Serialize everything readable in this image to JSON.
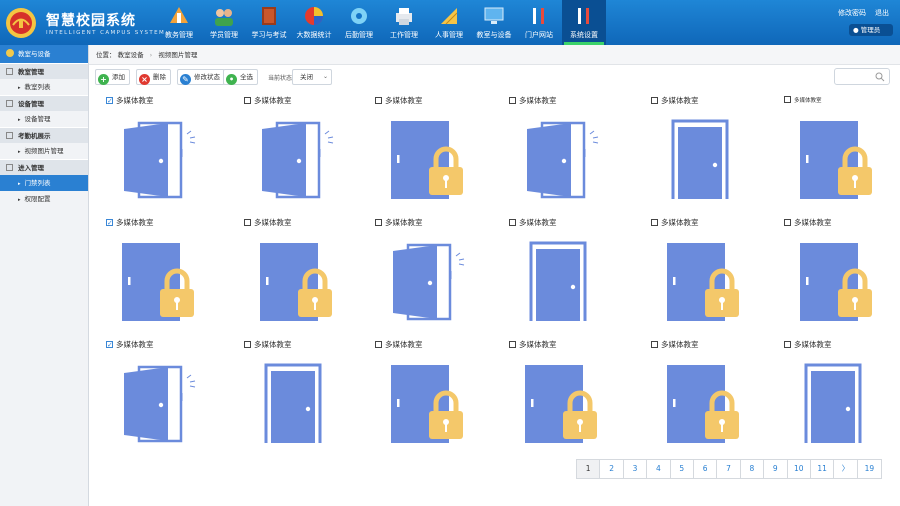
{
  "header": {
    "brand_title": "智慧校园系统",
    "brand_subtitle": "INTELLIGENT CAMPUS SYSTEM",
    "nav": [
      {
        "label": "教务管理",
        "icon": "tools-icon"
      },
      {
        "label": "学员管理",
        "icon": "students-icon"
      },
      {
        "label": "学习与考试",
        "icon": "book-icon"
      },
      {
        "label": "大数据统计",
        "icon": "pie-chart-icon"
      },
      {
        "label": "后勤管理",
        "icon": "gear-icon"
      },
      {
        "label": "工作管理",
        "icon": "printer-icon"
      },
      {
        "label": "人事管理",
        "icon": "ruler-icon"
      },
      {
        "label": "教室与设备",
        "icon": "monitor-icon"
      },
      {
        "label": "门户网站",
        "icon": "wrench-icon"
      },
      {
        "label": "系统设置",
        "icon": "settings-tools-icon",
        "active": true
      }
    ],
    "change_password": "修改密码",
    "logout": "退出",
    "user": "管理员"
  },
  "sidebar": {
    "top": "教室与设备",
    "groups": [
      {
        "label": "教室管理",
        "items": [
          {
            "label": "教室列表"
          }
        ]
      },
      {
        "label": "设备管理",
        "items": [
          {
            "label": "设备管理"
          }
        ]
      },
      {
        "label": "考勤机展示",
        "items": [
          {
            "label": "视频图片管理"
          }
        ]
      },
      {
        "label": "进入管理",
        "items": [
          {
            "label": "门禁列表",
            "active": true
          },
          {
            "label": "权限配置"
          }
        ]
      }
    ]
  },
  "breadcrumb": {
    "prefix": "位置：",
    "parent": "教室设备",
    "current": "视频图片管理"
  },
  "toolbar": {
    "add": "添加",
    "delete": "删除",
    "edit_status": "修改状态",
    "select_all": "全选",
    "status_label": "当前状态",
    "status_value": "关闭"
  },
  "cells": [
    {
      "label": "多媒体教室",
      "checked": true,
      "state": "open"
    },
    {
      "label": "多媒体教室",
      "checked": false,
      "state": "open"
    },
    {
      "label": "多媒体教室",
      "checked": false,
      "state": "locked"
    },
    {
      "label": "多媒体教室",
      "checked": false,
      "state": "open"
    },
    {
      "label": "多媒体教室",
      "checked": false,
      "state": "closed"
    },
    {
      "label": "多媒体教室",
      "checked": false,
      "state": "locked",
      "small": true
    },
    {
      "label": "多媒体教室",
      "checked": true,
      "state": "locked"
    },
    {
      "label": "多媒体教室",
      "checked": false,
      "state": "locked"
    },
    {
      "label": "多媒体教室",
      "checked": false,
      "state": "open"
    },
    {
      "label": "多媒体教室",
      "checked": false,
      "state": "closed"
    },
    {
      "label": "多媒体教室",
      "checked": false,
      "state": "locked"
    },
    {
      "label": "多媒体教室",
      "checked": false,
      "state": "locked"
    },
    {
      "label": "多媒体教室",
      "checked": true,
      "state": "open"
    },
    {
      "label": "多媒体教室",
      "checked": false,
      "state": "closed"
    },
    {
      "label": "多媒体教室",
      "checked": false,
      "state": "locked"
    },
    {
      "label": "多媒体教室",
      "checked": false,
      "state": "locked"
    },
    {
      "label": "多媒体教室",
      "checked": false,
      "state": "locked"
    },
    {
      "label": "多媒体教室",
      "checked": false,
      "state": "closed"
    }
  ],
  "pagination": {
    "current": "1",
    "pages": [
      "1",
      "2",
      "3",
      "4",
      "5",
      "6",
      "7",
      "8",
      "9",
      "10",
      "11"
    ],
    "next": "〉",
    "last": "19"
  },
  "colors": {
    "header": "#1478c8",
    "door": "#6b8bdc",
    "lock": "#f4c86a",
    "accent": "#2a80d2"
  }
}
